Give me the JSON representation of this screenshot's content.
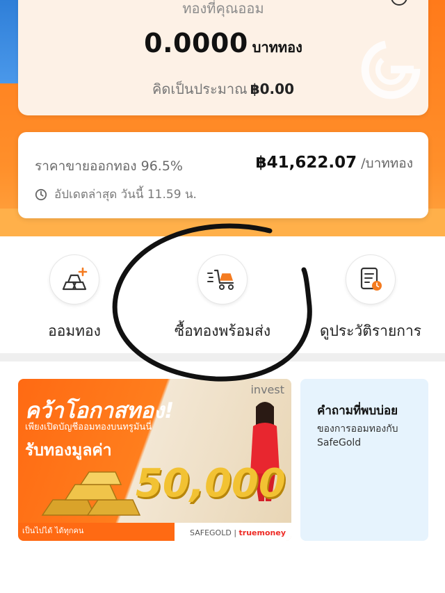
{
  "savings": {
    "caption": "ทองที่คุณออม",
    "amount": "0.0000",
    "unit": "บาททอง",
    "approx_label": "คิดเป็นประมาณ",
    "approx_value": "฿0.00"
  },
  "price": {
    "label": "ราคาขายออกทอง 96.5%",
    "value": "฿41,622.07",
    "unit": "/บาททอง",
    "updated": "อัปเดตล่าสุด วันนี้ 11.59 น."
  },
  "actions": [
    {
      "label": "ออมทอง",
      "icon": "gold-bars-add-icon"
    },
    {
      "label": "ซื้อทองพร้อมส่ง",
      "icon": "delivery-cart-icon"
    },
    {
      "label": "ดูประวัติรายการ",
      "icon": "history-list-icon"
    }
  ],
  "promo": {
    "invest": "invest",
    "title": "คว้าโอกาสทอง!",
    "subtitle": "เพียงเปิดบัญชีออมทองบนทรูมันนี่",
    "reward": "รับทองมูลค่า",
    "number": "50,000",
    "note": "เป็นไปได้ ได้ทุกคน",
    "brand_safegold": "SAFEGOLD",
    "brand_truemoney": "truemoney"
  },
  "faq": {
    "title": "คำถามที่พบบ่อย",
    "desc": "ของการออมทองกับ SafeGold"
  },
  "colors": {
    "orange": "#ff7a1a",
    "card_cream": "#fdf1e6",
    "faq_blue": "#e6f3fd",
    "accent_icon": "#f47b20"
  }
}
